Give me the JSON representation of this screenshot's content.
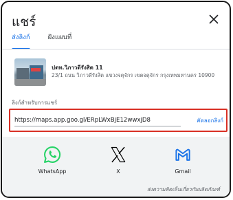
{
  "dialog": {
    "title": "แชร์",
    "close_icon": "close-icon"
  },
  "tabs": [
    {
      "label": "ส่งลิงก์",
      "active": true
    },
    {
      "label": "ฝังแผนที่",
      "active": false
    }
  ],
  "place": {
    "name": "ปตท.วิภาวดีรังสิต 11",
    "address": "23/1 ถนน วิภาวดีรังสิต แขวงจตุจักร เขตจตุจักร กรุงเทพมหานคร 10900"
  },
  "link": {
    "label": "ลิงก์สำหรับการแชร์",
    "url": "https://maps.app.goo.gl/ERpLWxBjE12wwxjD8",
    "copy_label": "คัดลอกลิงก์"
  },
  "share_targets": [
    {
      "label": "WhatsApp",
      "icon": "whatsapp-icon",
      "color": "#25D366"
    },
    {
      "label": "X",
      "icon": "x-icon",
      "color": "#000000"
    },
    {
      "label": "Gmail",
      "icon": "gmail-icon",
      "color": "#1a73e8"
    }
  ],
  "feedback": "ส่งความคิดเห็นเกี่ยวกับผลิตภัณฑ์",
  "colors": {
    "accent": "#1a73e8",
    "highlight_border": "#d93025",
    "share_bg": "#f1f3f4"
  }
}
